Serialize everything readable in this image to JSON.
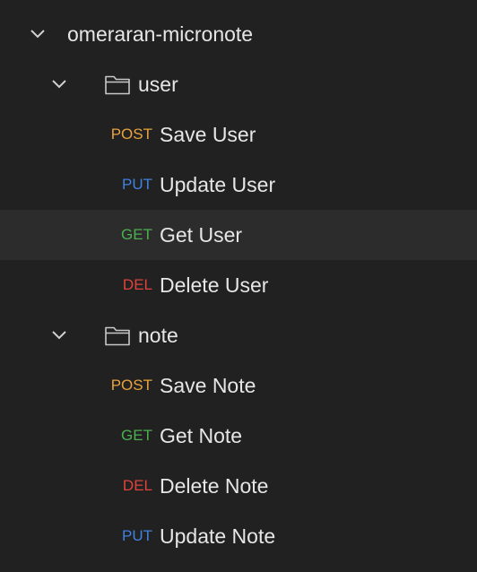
{
  "collection": {
    "name": "omeraran-micronote",
    "folders": [
      {
        "name": "user",
        "requests": [
          {
            "method": "POST",
            "name": "Save User",
            "method_color": "#e8a33d"
          },
          {
            "method": "PUT",
            "name": "Update User",
            "method_color": "#3f82e0"
          },
          {
            "method": "GET",
            "name": "Get User",
            "method_color": "#4caf50"
          },
          {
            "method": "DEL",
            "name": "Delete User",
            "method_color": "#e0433d"
          }
        ]
      },
      {
        "name": "note",
        "requests": [
          {
            "method": "POST",
            "name": "Save Note",
            "method_color": "#e8a33d"
          },
          {
            "method": "GET",
            "name": "Get Note",
            "method_color": "#4caf50"
          },
          {
            "method": "DEL",
            "name": "Delete Note",
            "method_color": "#e0433d"
          },
          {
            "method": "PUT",
            "name": "Update Note",
            "method_color": "#3f82e0"
          }
        ]
      }
    ]
  },
  "icons": {
    "expand": "chevron-down-icon",
    "folder": "folder-icon"
  },
  "selected_request": "Get User"
}
